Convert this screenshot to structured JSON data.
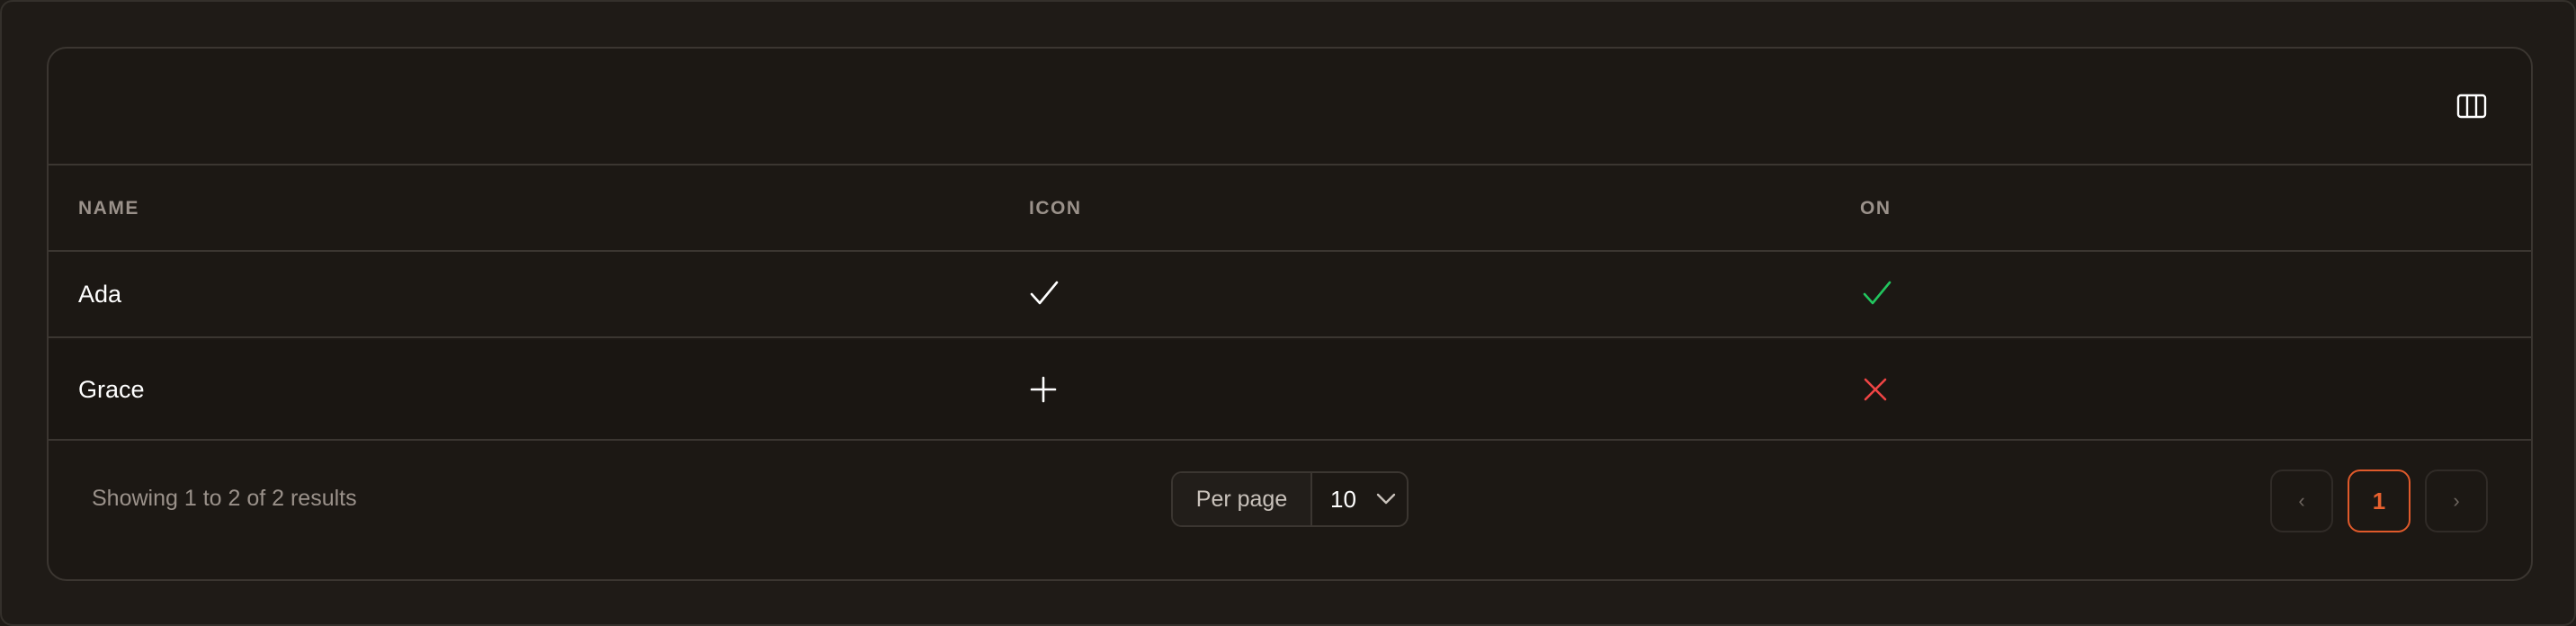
{
  "toolbar": {
    "columns_toggle_icon": "columns-icon"
  },
  "table": {
    "headers": {
      "name": "NAME",
      "icon": "ICON",
      "on": "ON"
    },
    "rows": [
      {
        "name": "Ada",
        "icon": "check-icon",
        "on": "check-icon",
        "on_color": "#22c55e"
      },
      {
        "name": "Grace",
        "icon": "plus-icon",
        "on": "x-icon",
        "on_color": "#ef4444"
      }
    ]
  },
  "footer": {
    "showing": "Showing 1 to 2 of 2 results",
    "per_page_label": "Per page",
    "per_page_value": "10",
    "pagination": {
      "prev": "‹",
      "current": "1",
      "next": "›"
    }
  },
  "colors": {
    "accent": "#e8612f",
    "success": "#22c55e",
    "danger": "#ef4444"
  }
}
